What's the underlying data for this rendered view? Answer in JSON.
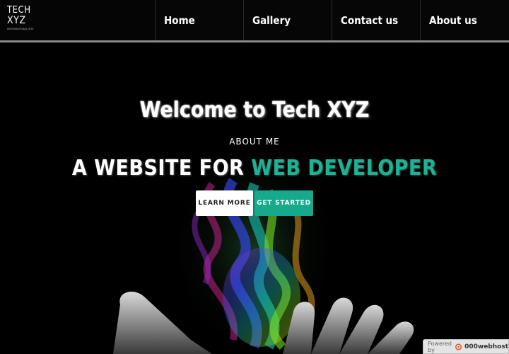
{
  "nav": {
    "logo_line1": "TECH",
    "logo_line2": "XYZ",
    "logo_tagline": "INFORMATIONAL SITE",
    "items": [
      {
        "label": "Home"
      },
      {
        "label": "Gallery"
      },
      {
        "label": "Contact us"
      },
      {
        "label": "About us"
      }
    ]
  },
  "hero": {
    "welcome": "Welcome to Tech XYZ",
    "about": "ABOUT ME",
    "headline_prefix": "A WEBSITE FOR ",
    "headline_accent": "WEB DEVELOPER",
    "learn_more": "LEARN MORE",
    "get_started": "GET STARTED",
    "image_icon": "hand-with-rainbow-smoke"
  },
  "footer_badge": {
    "label": "Powered by",
    "brand": "000webhost",
    "icon": "000webhost-logo-icon"
  },
  "colors": {
    "background": "#000000",
    "accent": "#1ab394",
    "button_primary": "#16a98b",
    "nav_border": "#8a8a8a"
  }
}
